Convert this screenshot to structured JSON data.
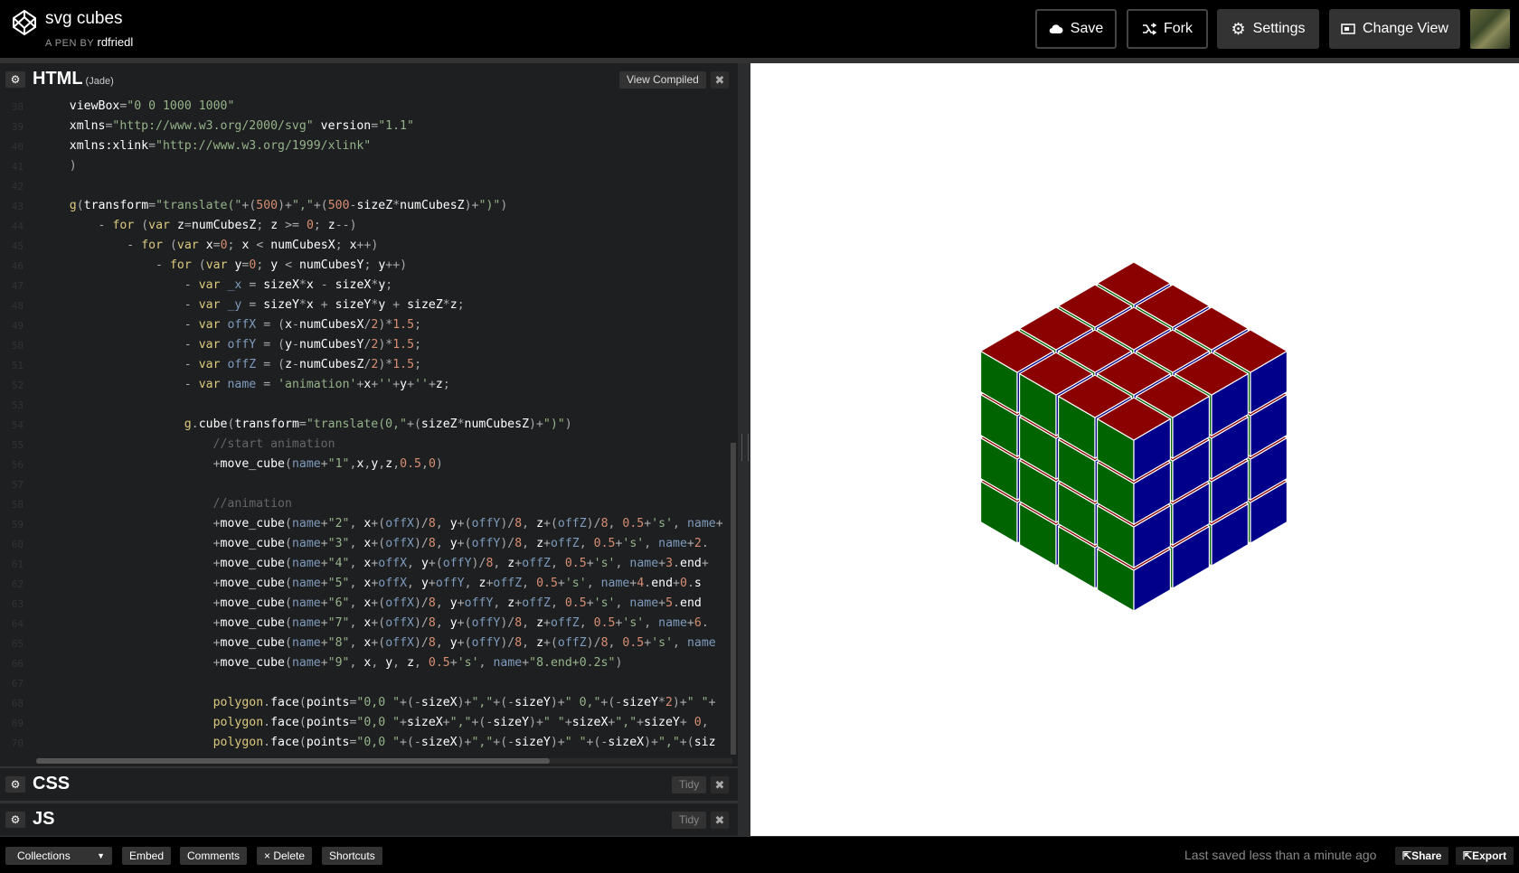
{
  "header": {
    "title": "svg cubes",
    "by_label": "A PEN BY",
    "author": "rdfriedl",
    "buttons": {
      "save": "Save",
      "fork": "Fork",
      "settings": "Settings",
      "change_view": "Change View"
    }
  },
  "html_editor": {
    "title": "HTML",
    "preprocessor": "(Jade)",
    "view_compiled": "View Compiled",
    "close": "✖"
  },
  "css_editor": {
    "title": "CSS",
    "tidy": "Tidy",
    "close": "✖"
  },
  "js_editor": {
    "title": "JS",
    "tidy": "Tidy",
    "close": "✖"
  },
  "code_lines": [
    {
      "n": "38",
      "text": "    viewBox=\"0 0 1000 1000\""
    },
    {
      "n": "39",
      "text": "    xmlns=\"http://www.w3.org/2000/svg\" version=\"1.1\""
    },
    {
      "n": "40",
      "text": "    xmlns:xlink=\"http://www.w3.org/1999/xlink\""
    },
    {
      "n": "41",
      "text": "    )"
    },
    {
      "n": "42",
      "text": ""
    },
    {
      "n": "43",
      "text": "    g(transform=\"translate(\"+(500)+\",\"+(500-sizeZ*numCubesZ)+\")\")"
    },
    {
      "n": "44",
      "text": "        - for (var z=numCubesZ; z >= 0; z--)"
    },
    {
      "n": "45",
      "text": "            - for (var x=0; x < numCubesX; x++)"
    },
    {
      "n": "46",
      "text": "                - for (var y=0; y < numCubesY; y++)"
    },
    {
      "n": "47",
      "text": "                    - var _x = sizeX*x - sizeX*y;"
    },
    {
      "n": "48",
      "text": "                    - var _y = sizeY*x + sizeY*y + sizeZ*z;"
    },
    {
      "n": "49",
      "text": "                    - var offX = (x-numCubesX/2)*1.5;"
    },
    {
      "n": "50",
      "text": "                    - var offY = (y-numCubesY/2)*1.5;"
    },
    {
      "n": "51",
      "text": "                    - var offZ = (z-numCubesZ/2)*1.5;"
    },
    {
      "n": "52",
      "text": "                    - var name = 'animation'+x+''+y+''+z;"
    },
    {
      "n": "53",
      "text": ""
    },
    {
      "n": "54",
      "text": "                    g.cube(transform=\"translate(0,\"+(sizeZ*numCubesZ)+\")\")"
    },
    {
      "n": "55",
      "text": "                        //start animation"
    },
    {
      "n": "56",
      "text": "                        +move_cube(name+\"1\",x,y,z,0.5,0)"
    },
    {
      "n": "57",
      "text": ""
    },
    {
      "n": "58",
      "text": "                        //animation"
    },
    {
      "n": "59",
      "text": "                        +move_cube(name+\"2\", x+(offX)/8, y+(offY)/8, z+(offZ)/8, 0.5+'s', name+"
    },
    {
      "n": "60",
      "text": "                        +move_cube(name+\"3\", x+(offX)/8, y+(offY)/8, z+offZ, 0.5+'s', name+\"2."
    },
    {
      "n": "61",
      "text": "                        +move_cube(name+\"4\", x+offX, y+(offY)/8, z+offZ, 0.5+'s', name+\"3.end+"
    },
    {
      "n": "62",
      "text": "                        +move_cube(name+\"5\", x+offX, y+offY, z+offZ, 0.5+'s', name+\"4.end+0.2s"
    },
    {
      "n": "63",
      "text": "                        +move_cube(name+\"6\", x+(offX)/8, y+offY, z+offZ, 0.5+'s', name+\"5.end"
    },
    {
      "n": "64",
      "text": "                        +move_cube(name+\"7\", x+(offX)/8, y+(offY)/8, z+offZ, 0.5+'s', name+\"6."
    },
    {
      "n": "65",
      "text": "                        +move_cube(name+\"8\", x+(offX)/8, y+(offY)/8, z+(offZ)/8, 0.5+'s', name"
    },
    {
      "n": "66",
      "text": "                        +move_cube(name+\"9\", x, y, z, 0.5+'s', name+\"8.end+0.2s\")"
    },
    {
      "n": "67",
      "text": ""
    },
    {
      "n": "68",
      "text": "                        polygon.face(points=\"0,0 \"+(-sizeX)+\",\"+(-sizeY)+\" 0,\"+(-sizeY*2)+\" \"+"
    },
    {
      "n": "69",
      "text": "                        polygon.face(points=\"0,0 \"+sizeX+\",\"+(-sizeY)+\" \"+sizeX+\",\"+sizeY+\" 0,"
    },
    {
      "n": "70",
      "text": "                        polygon.face(points=\"0,0 \"+(-sizeX)+\",\"+(-sizeY)+\" \"+(-sizeX)+\",\"+(siz"
    }
  ],
  "footer": {
    "collections": "Collections",
    "embed": "Embed",
    "comments": "Comments",
    "delete": "× Delete",
    "shortcuts": "Shortcuts",
    "last_saved": "Last saved less than a minute ago",
    "share": "Share",
    "export": "Export"
  },
  "preview": {
    "cube_colors": {
      "top": "#8b0000",
      "left": "#006400",
      "right": "#00008b"
    }
  }
}
